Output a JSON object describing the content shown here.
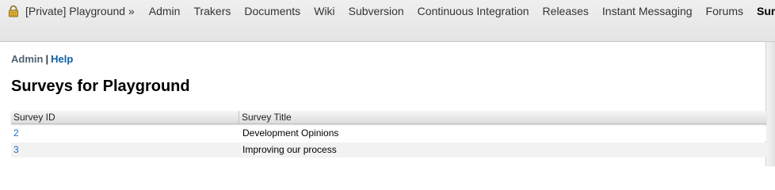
{
  "header": {
    "project": "[Private] Playground »",
    "nav_items": [
      {
        "label": "Admin",
        "active": false
      },
      {
        "label": "Trakers",
        "active": false
      },
      {
        "label": "Documents",
        "active": false
      },
      {
        "label": "Wiki",
        "active": false
      },
      {
        "label": "Subversion",
        "active": false
      },
      {
        "label": "Continuous Integration",
        "active": false
      },
      {
        "label": "Releases",
        "active": false
      },
      {
        "label": "Instant Messaging",
        "active": false
      },
      {
        "label": "Forums",
        "active": false
      },
      {
        "label": "Surveys",
        "active": true
      }
    ],
    "icon": "lock-icon"
  },
  "subnav": {
    "admin": "Admin",
    "separator": "|",
    "help": "Help"
  },
  "page_title": "Surveys for Playground",
  "table": {
    "headers": {
      "id": "Survey ID",
      "title": "Survey Title"
    },
    "rows": [
      {
        "id": "2",
        "title": "Development Opinions"
      },
      {
        "id": "3",
        "title": "Improving our process"
      }
    ]
  },
  "colors": {
    "link": "#1a6fc4",
    "help_link": "#0b5fa5",
    "admin_link": "#4e6275"
  }
}
